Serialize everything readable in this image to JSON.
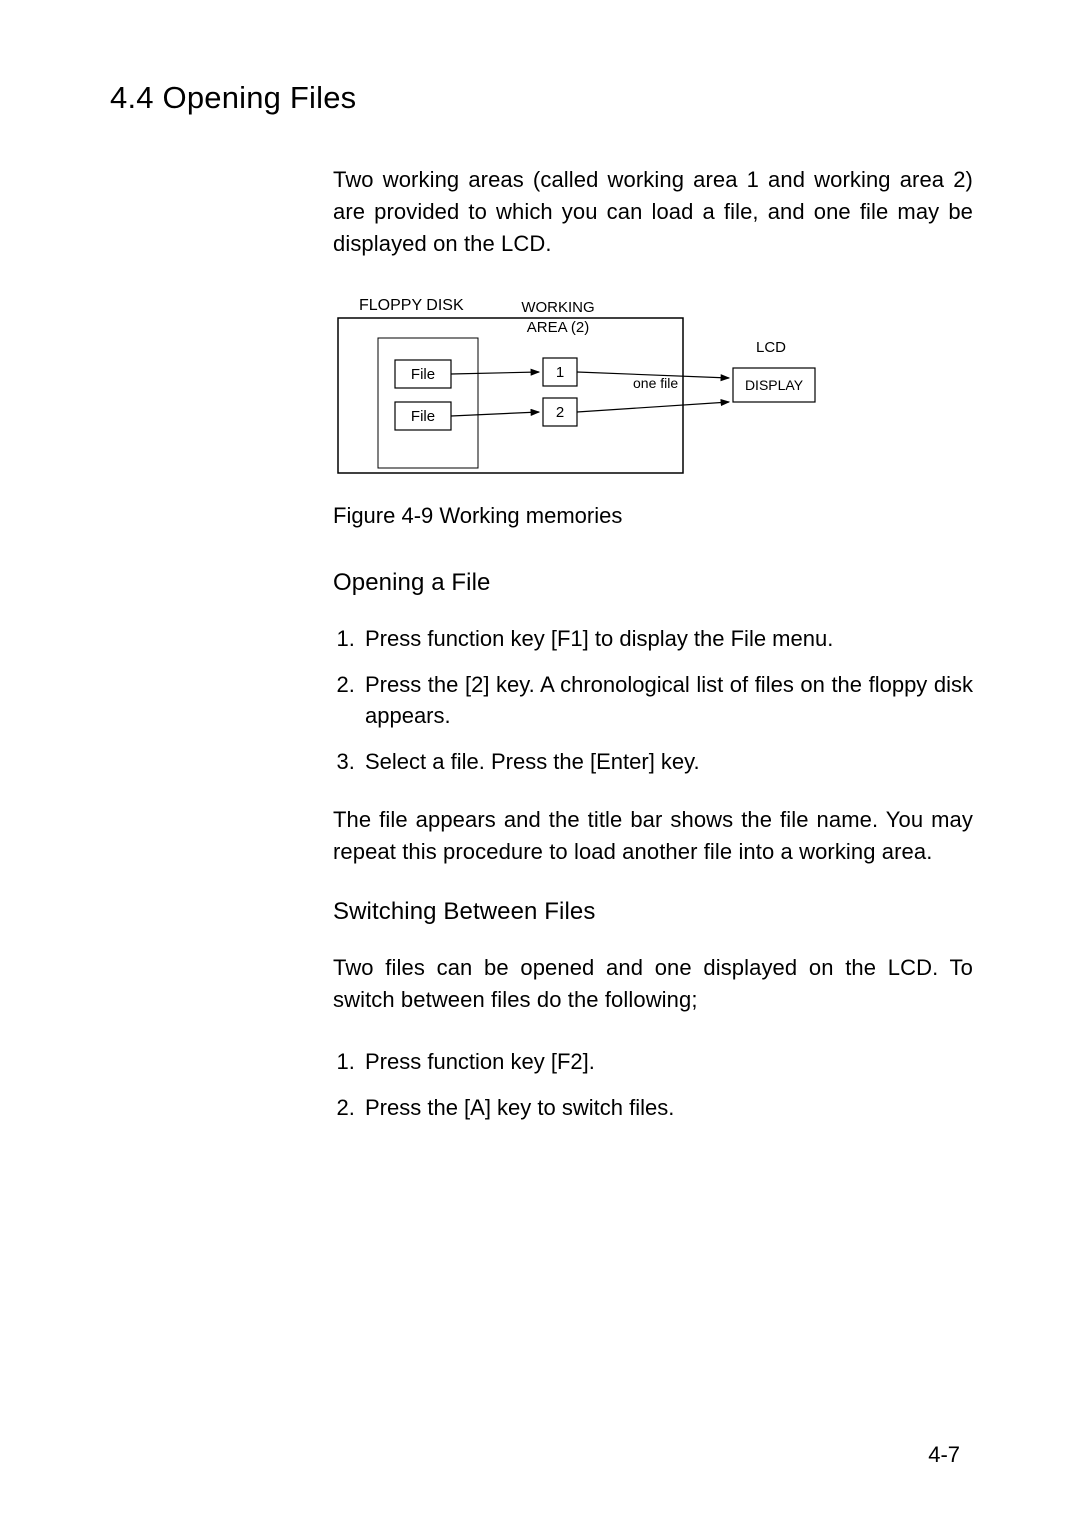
{
  "section_title": "4.4 Opening Files",
  "intro": "Two working areas (called working area 1 and working area 2) are provided to which you can load a file, and one file may be displayed on the LCD.",
  "figure_caption": "Figure 4-9 Working memories",
  "diagram": {
    "floppy_label": "FLOPPY DISK",
    "working_area_label_l1": "WORKING",
    "working_area_label_l2": "AREA (2)",
    "file_label_1": "File",
    "file_label_2": "File",
    "slot_1": "1",
    "slot_2": "2",
    "one_file": "one file",
    "lcd_label": "LCD",
    "display_label": "DISPLAY"
  },
  "open": {
    "heading": "Opening a File",
    "steps": [
      "Press function key [F1] to display the File menu.",
      " Press the [2] key. A chronological list of files on the floppy disk appears.",
      " Select a file. Press the [Enter] key."
    ],
    "after": "The file appears and the title bar shows the file name. You may repeat this procedure to load another file into a working area."
  },
  "switch": {
    "heading": "Switching Between Files",
    "intro": "Two files can be opened and one displayed on the LCD. To switch between files do the following;",
    "steps": [
      " Press function key [F2].",
      " Press the [A] key to switch files."
    ]
  },
  "page_number": "4-7"
}
